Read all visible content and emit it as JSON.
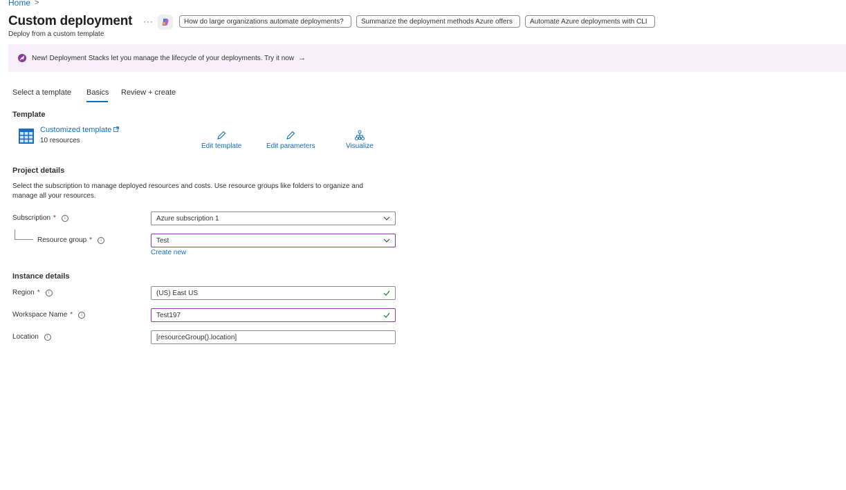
{
  "breadcrumb": {
    "home": "Home",
    "separator": ">"
  },
  "header": {
    "title": "Custom deployment",
    "subtitle": "Deploy from a custom template",
    "more": "···",
    "suggestions": [
      "How do large organizations automate deployments?",
      "Summarize the deployment methods Azure offers",
      "Automate Azure deployments with CLI"
    ]
  },
  "banner": {
    "text": "New! Deployment Stacks let you manage the lifecycle of your deployments. Try it now",
    "arrow": "→",
    "background": "#f7f0fa"
  },
  "tabs": [
    {
      "label": "Select a template",
      "selected": false
    },
    {
      "label": "Basics",
      "selected": true
    },
    {
      "label": "Review + create",
      "selected": false
    }
  ],
  "template": {
    "section_title": "Template",
    "name": "Customized template",
    "resources": "10 resources",
    "actions": {
      "edit_template": "Edit template",
      "edit_parameters": "Edit parameters",
      "visualize": "Visualize"
    }
  },
  "project": {
    "section_title": "Project details",
    "description": "Select the subscription to manage deployed resources and costs. Use resource groups like folders to organize and manage all your resources.",
    "subscription": {
      "label": "Subscription",
      "required": "*",
      "value": "Azure subscription 1"
    },
    "resource_group": {
      "label": "Resource group",
      "required": "*",
      "value": "Test",
      "create_new": "Create new"
    }
  },
  "instance": {
    "section_title": "Instance details",
    "region": {
      "label": "Region",
      "required": "*",
      "value": "(US) East US"
    },
    "workspace": {
      "label": "Workspace Name",
      "required": "*",
      "value": "Test197"
    },
    "location": {
      "label": "Location",
      "value": "[resourceGroup().location]"
    }
  },
  "colors": {
    "accent": "#0f6cbd",
    "focus": "#8a3a9e",
    "valid": "#107c10",
    "required": "#a4262c"
  }
}
